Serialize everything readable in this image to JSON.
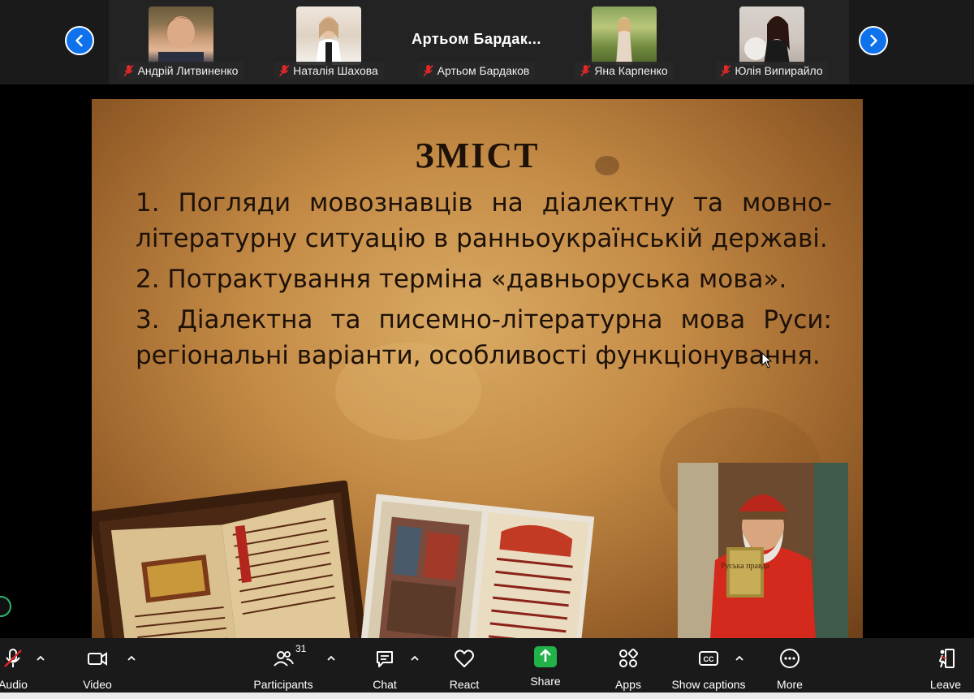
{
  "participants": [
    {
      "name": "Андрій Литвиненко",
      "muted": true,
      "has_video": true
    },
    {
      "name": "Наталія Шахова",
      "muted": true,
      "has_video": true
    },
    {
      "name": "Артьом Бардаков",
      "display_title": "Артьом  Бардак...",
      "muted": true,
      "has_video": false
    },
    {
      "name": "Яна Карпенко",
      "muted": true,
      "has_video": true
    },
    {
      "name": "Юлія Випирайло",
      "muted": true,
      "has_video": true
    }
  ],
  "slide": {
    "title": "ЗМІСТ",
    "items": [
      "1. Погляди мовознавців на діалектну та мовно-літературну ситуацію в ранньоукраїнській державі.",
      "2. Потрактування терміна «давньоруська мова».",
      "3. Діалектна та писемно-літературна мова Руси: регіональні варіанти, особливості функціонування."
    ],
    "book_inscription": "Руська правда"
  },
  "toolbar": {
    "audio": "Audio",
    "video": "Video",
    "participants": "Participants",
    "participants_count": "31",
    "chat": "Chat",
    "react": "React",
    "share": "Share",
    "apps": "Apps",
    "captions": "Show captions",
    "more": "More",
    "leave": "Leave"
  },
  "colors": {
    "accent_blue": "#0e72ed",
    "share_green": "#21b24a",
    "mute_red": "#e02828",
    "toolbar_bg": "#1a1a1a",
    "leave_red": "#e02828"
  }
}
